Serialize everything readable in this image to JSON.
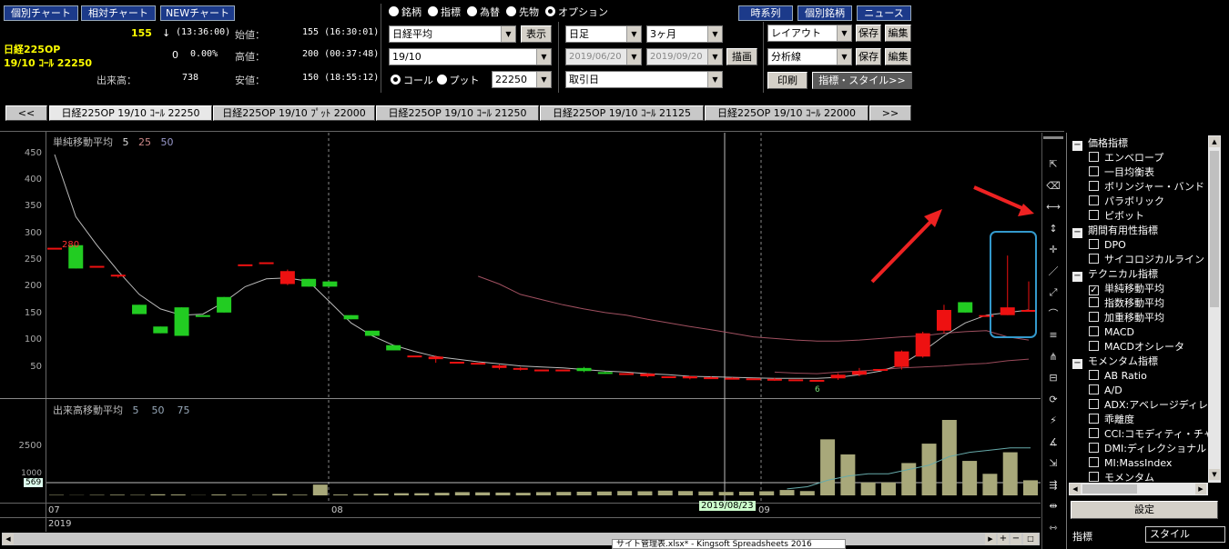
{
  "topbar": {
    "btn_individual": "個別チャート",
    "btn_relative": "相対チャート",
    "btn_new": "NEWチャート",
    "btn_timeseries": "時系列",
    "btn_stock": "個別銘柄",
    "btn_news": "ニュース"
  },
  "quote": {
    "price": "155",
    "arrow": "↓",
    "time": "(13:36:00)",
    "name": "日経225OP",
    "contract": "19/10 ｺｰﾙ 22250",
    "change": "0",
    "change_pct": "0.00%",
    "open_label": "始値：",
    "open_val": "155 (16:30:01)",
    "high_label": "高値：",
    "high_val": "200 (00:37:48)",
    "low_label": "安値：",
    "low_val": "150 (18:55:12)",
    "volume_label": "出来高：",
    "volume_val": "738"
  },
  "asset_radios": [
    {
      "label": "銘柄",
      "on": false
    },
    {
      "label": "指標",
      "on": false
    },
    {
      "label": "為替",
      "on": false
    },
    {
      "label": "先物",
      "on": false
    },
    {
      "label": "オプション",
      "on": true
    }
  ],
  "controls": {
    "index_select": "日経平均",
    "show_btn": "表示",
    "month_select": "19/10",
    "call_label": "コール",
    "put_label": "プット",
    "strike_select": "22250",
    "period_select": "日足",
    "range_select": "3ヶ月",
    "date_from": "2019/06/20",
    "date_to": "2019/09/20",
    "draw_btn": "描画",
    "basis_select": "取引日",
    "layout_select": "レイアウト",
    "save_btn": "保存",
    "edit_btn": "編集",
    "analysis_select": "分析線",
    "save_btn2": "保存",
    "edit_btn2": "編集",
    "print_btn": "印刷",
    "indicator_style_btn": "指標・スタイル>>"
  },
  "tabs": {
    "prev": "<<",
    "next": ">>",
    "items": [
      "日経225OP 19/10 ｺｰﾙ 22250",
      "日経225OP 19/10 ﾌﾟｯﾄ 22000",
      "日経225OP 19/10 ｺｰﾙ 21250",
      "日経225OP 19/10 ｺｰﾙ 21125",
      "日経225OP 19/10 ｺｰﾙ 22000"
    ]
  },
  "chart_data": {
    "type": "candlestick",
    "title": "単純移動平均",
    "ma_periods": [
      "5",
      "25",
      "50"
    ],
    "ylim": [
      0,
      470
    ],
    "yticks": [
      "450",
      "400",
      "350",
      "300",
      "250",
      "200",
      "150",
      "100",
      "50"
    ],
    "last_label": "280",
    "end_label": "6",
    "candles": [
      [
        270,
        270,
        270,
        270
      ],
      [
        275,
        230,
        278,
        228
      ],
      [
        235,
        235,
        237,
        233
      ],
      [
        215,
        218,
        212,
        218
      ],
      [
        160,
        142,
        165,
        140
      ],
      [
        118,
        105,
        122,
        103
      ],
      [
        155,
        100,
        158,
        97
      ],
      [
        140,
        137,
        143,
        135
      ],
      [
        175,
        145,
        178,
        143
      ],
      [
        238,
        238,
        238,
        238
      ],
      [
        242,
        242,
        242,
        242
      ],
      [
        200,
        225,
        198,
        228
      ],
      [
        210,
        195,
        212,
        193
      ],
      [
        205,
        195,
        228,
        193
      ],
      [
        140,
        132,
        142,
        130
      ],
      [
        110,
        100,
        112,
        98
      ],
      [
        82,
        72,
        88,
        55
      ],
      [
        62,
        62,
        64,
        60
      ],
      [
        55,
        60,
        48,
        62
      ],
      [
        50,
        50,
        52,
        48
      ],
      [
        48,
        48,
        50,
        46
      ],
      [
        38,
        43,
        35,
        45
      ],
      [
        35,
        38,
        33,
        40
      ],
      [
        35,
        35,
        37,
        33
      ],
      [
        35,
        35,
        37,
        33
      ],
      [
        38,
        32,
        30,
        40
      ],
      [
        30,
        28,
        27,
        31
      ],
      [
        28,
        28,
        30,
        26
      ],
      [
        22,
        27,
        20,
        28
      ],
      [
        22,
        22,
        24,
        20
      ],
      [
        18,
        22,
        16,
        23
      ],
      [
        18,
        20,
        17,
        22
      ],
      [
        17,
        19,
        16,
        20
      ],
      [
        18,
        18,
        19,
        17
      ],
      [
        15,
        17,
        13,
        19
      ],
      [
        16,
        16,
        17,
        15
      ],
      [
        15,
        15,
        16,
        14
      ],
      [
        18,
        25,
        15,
        28
      ],
      [
        25,
        32,
        22,
        38
      ],
      [
        36,
        36,
        38,
        34
      ],
      [
        40,
        70,
        35,
        72
      ],
      [
        60,
        105,
        58,
        108
      ],
      [
        110,
        150,
        105,
        160
      ],
      [
        165,
        145,
        178,
        143
      ],
      [
        140,
        140,
        142,
        138
      ],
      [
        140,
        155,
        140,
        255
      ],
      [
        150,
        150,
        150,
        205
      ]
    ],
    "ma_short": [
      450,
      330,
      275,
      225,
      180,
      152,
      140,
      142,
      165,
      195,
      210,
      212,
      205,
      165,
      125,
      100,
      82,
      70,
      60,
      55,
      50,
      46,
      42,
      40,
      38,
      35,
      32,
      30,
      27,
      25,
      22,
      21,
      20,
      19,
      18,
      18,
      18,
      20,
      25,
      32,
      45,
      70,
      100,
      125,
      140,
      145,
      150
    ],
    "ma_long": [
      null,
      null,
      null,
      null,
      null,
      null,
      null,
      null,
      null,
      null,
      null,
      null,
      null,
      null,
      null,
      null,
      null,
      null,
      null,
      null,
      215,
      200,
      180,
      170,
      160,
      152,
      145,
      140,
      132,
      125,
      118,
      112,
      105,
      98,
      95,
      92,
      90,
      90,
      92,
      95,
      98,
      100,
      105,
      108,
      110,
      98,
      92
    ],
    "ma_mid": [
      null,
      null,
      null,
      null,
      null,
      null,
      null,
      null,
      null,
      null,
      null,
      null,
      null,
      null,
      null,
      null,
      null,
      null,
      null,
      null,
      null,
      null,
      null,
      null,
      null,
      null,
      null,
      null,
      null,
      null,
      null,
      null,
      null,
      null,
      30,
      28,
      27,
      30,
      32,
      35,
      38,
      40,
      42,
      45,
      47,
      52,
      55
    ]
  },
  "volume": {
    "title": "出来高移動平均",
    "periods": [
      "5",
      "50",
      "75"
    ],
    "yticks": [
      "2500",
      "1000"
    ],
    "current": "569",
    "values": [
      20,
      10,
      20,
      30,
      20,
      50,
      40,
      10,
      40,
      30,
      20,
      60,
      30,
      500,
      40,
      60,
      80,
      100,
      100,
      120,
      150,
      140,
      130,
      120,
      150,
      160,
      170,
      180,
      200,
      190,
      220,
      200,
      180,
      160,
      170,
      190,
      250,
      200,
      2600,
      1900,
      600,
      600,
      1500,
      2400,
      3500,
      1600,
      1000,
      2000,
      700
    ],
    "ma": [
      null,
      null,
      null,
      null,
      null,
      null,
      null,
      null,
      null,
      null,
      null,
      null,
      null,
      null,
      null,
      null,
      null,
      null,
      null,
      null,
      null,
      null,
      null,
      null,
      null,
      null,
      null,
      null,
      null,
      null,
      null,
      null,
      null,
      null,
      null,
      null,
      300,
      400,
      700,
      900,
      1000,
      1000,
      1200,
      1400,
      1800,
      2000,
      2100,
      2200,
      2200
    ]
  },
  "xaxis": {
    "month_07": "07",
    "month_08": "08",
    "month_09": "09",
    "year": "2019",
    "cursor_date": "2019/08/23"
  },
  "tools": [
    "pointer-icon",
    "eraser-icon",
    "hline-icon",
    "vline-icon",
    "cross-icon",
    "trendline-icon",
    "fan-icon",
    "arc-icon",
    "fibonacci-icon",
    "pitchfork-icon",
    "retracement-icon",
    "cycle-icon",
    "zigzag-icon",
    "gann-icon",
    "stretch-icon",
    "channel-icon",
    "fit-icon",
    "extend-icon"
  ],
  "indicators": [
    {
      "type": "group",
      "label": "価格指標"
    },
    {
      "type": "item",
      "label": "エンベロープ",
      "checked": false
    },
    {
      "type": "item",
      "label": "一目均衡表",
      "checked": false
    },
    {
      "type": "item",
      "label": "ボリンジャー・バンド",
      "checked": false
    },
    {
      "type": "item",
      "label": "パラボリック",
      "checked": false
    },
    {
      "type": "item",
      "label": "ピボット",
      "checked": false
    },
    {
      "type": "group",
      "label": "期間有用性指標"
    },
    {
      "type": "item",
      "label": "DPO",
      "checked": false
    },
    {
      "type": "item",
      "label": "サイコロジカルライン",
      "checked": false
    },
    {
      "type": "group",
      "label": "テクニカル指標"
    },
    {
      "type": "item",
      "label": "単純移動平均",
      "checked": true
    },
    {
      "type": "item",
      "label": "指数移動平均",
      "checked": false
    },
    {
      "type": "item",
      "label": "加重移動平均",
      "checked": false
    },
    {
      "type": "item",
      "label": "MACD",
      "checked": false
    },
    {
      "type": "item",
      "label": "MACDオシレータ",
      "checked": false
    },
    {
      "type": "group",
      "label": "モメンタム指標"
    },
    {
      "type": "item",
      "label": "AB Ratio",
      "checked": false
    },
    {
      "type": "item",
      "label": "A/D",
      "checked": false
    },
    {
      "type": "item",
      "label": "ADX:アベレージディレ",
      "checked": false
    },
    {
      "type": "item",
      "label": "乖離度",
      "checked": false
    },
    {
      "type": "item",
      "label": "CCI:コモディティ・チャ",
      "checked": false
    },
    {
      "type": "item",
      "label": "DMI:ディレクショナル",
      "checked": false
    },
    {
      "type": "item",
      "label": "MI:MassIndex",
      "checked": false
    },
    {
      "type": "item",
      "label": "モメンタム",
      "checked": false
    }
  ],
  "panel": {
    "settings_btn": "設定",
    "tab_indicator": "指標",
    "tab_style": "スタイル"
  },
  "taskbar_tooltip": "サイト管理表.xlsx* - Kingsoft Spreadsheets 2016"
}
